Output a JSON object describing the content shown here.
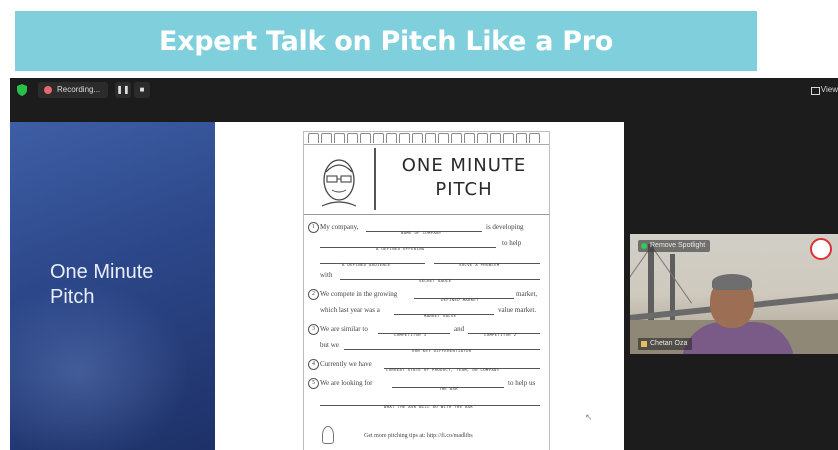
{
  "banner": {
    "title": "Expert Talk on Pitch Like a Pro",
    "background": "#7fd0dc"
  },
  "zoom": {
    "recording": {
      "label": "Recording...",
      "pause_icon": "pause-icon",
      "stop_icon": "stop-icon"
    },
    "view_label": "View",
    "shared_screen": {
      "slide_title": "One Minute\nPitch",
      "worksheet": {
        "title": "ONE MINUTE\nPITCH",
        "rows": [
          {
            "num": "1",
            "text": "My company,",
            "hint": "NAME OF COMPANY",
            "after": "is developing"
          },
          {
            "num": "",
            "text": "",
            "hint": "A DEFINED OFFERING",
            "after": "to help"
          },
          {
            "num": "",
            "text": "",
            "hint": "A DEFINED AUDIENCE",
            "hint2": "SOLVE A PROBLEM",
            "after": ""
          },
          {
            "num": "",
            "text": "with",
            "hint": "SECRET SAUCE",
            "after": ""
          },
          {
            "num": "2",
            "text": "We compete in the growing",
            "hint": "DEFINED MARKET",
            "after": "market,"
          },
          {
            "num": "",
            "text": "which last year was a",
            "hint": "MARKET VALUE",
            "after": "value market."
          },
          {
            "num": "3",
            "text": "We are similar to",
            "hint": "COMPETITOR 1",
            "mid": "and",
            "hint2": "COMPETITOR 2",
            "after": ""
          },
          {
            "num": "",
            "text": "but we",
            "hint": "OUR KEY DIFFERENTIATOR",
            "after": ""
          },
          {
            "num": "4",
            "text": "Currently we have",
            "hint": "CURRENT STATE OF PRODUCT, TEAM, OR COMPANY",
            "after": ""
          },
          {
            "num": "5",
            "text": "We are looking for",
            "hint": "THE ASK",
            "after": "to help us"
          },
          {
            "num": "",
            "text": "",
            "hint": "WHAT THE ASK WILL DO WITH THE ASK",
            "after": ""
          }
        ],
        "footer": "Get more pitching tips at: http://fi.co/madlibs"
      }
    },
    "video": {
      "spotlight_label": "Remove Spotlight",
      "participant_name": "Chetan Oza"
    }
  }
}
